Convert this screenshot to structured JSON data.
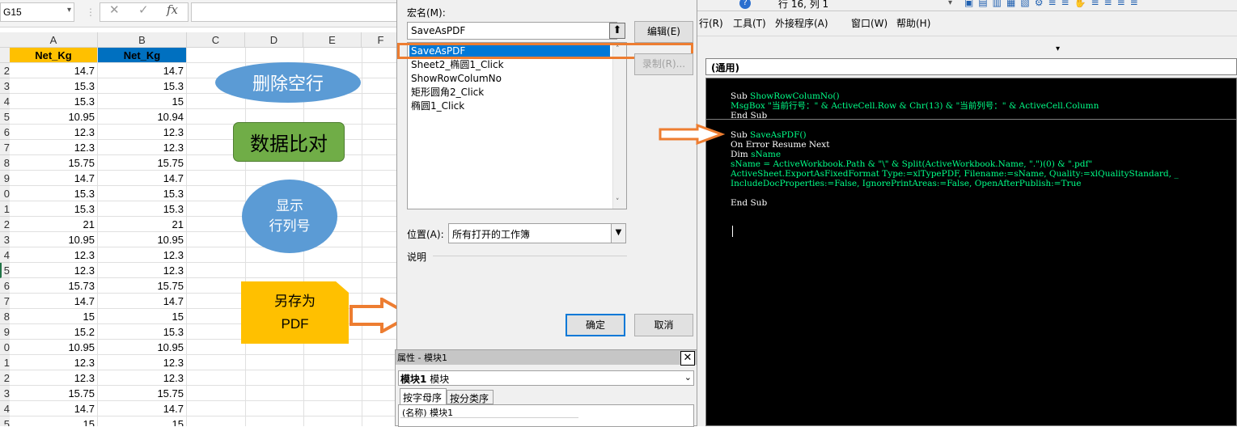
{
  "excel": {
    "name_box": "G15",
    "fx_cancel": "✕",
    "fx_enter": "✓",
    "fx_label": "fx",
    "columns": [
      "A",
      "B",
      "C",
      "D",
      "E",
      "F"
    ],
    "header_a": "Net_Kg",
    "header_b": "Net_Kg",
    "rows": [
      {
        "num": "2",
        "a": "14.7",
        "b": "14.7"
      },
      {
        "num": "3",
        "a": "15.3",
        "b": "15.3"
      },
      {
        "num": "4",
        "a": "15.3",
        "b": "15"
      },
      {
        "num": "5",
        "a": "10.95",
        "b": "10.94"
      },
      {
        "num": "6",
        "a": "12.3",
        "b": "12.3"
      },
      {
        "num": "7",
        "a": "12.3",
        "b": "12.3"
      },
      {
        "num": "8",
        "a": "15.75",
        "b": "15.75"
      },
      {
        "num": "9",
        "a": "14.7",
        "b": "14.7"
      },
      {
        "num": "0",
        "a": "15.3",
        "b": "15.3"
      },
      {
        "num": "1",
        "a": "15.3",
        "b": "15.3"
      },
      {
        "num": "2",
        "a": "21",
        "b": "21"
      },
      {
        "num": "3",
        "a": "10.95",
        "b": "10.95"
      },
      {
        "num": "4",
        "a": "12.3",
        "b": "12.3"
      },
      {
        "num": "5",
        "a": "12.3",
        "b": "12.3"
      },
      {
        "num": "6",
        "a": "15.73",
        "b": "15.75"
      },
      {
        "num": "7",
        "a": "14.7",
        "b": "14.7"
      },
      {
        "num": "8",
        "a": "15",
        "b": "15"
      },
      {
        "num": "9",
        "a": "15.2",
        "b": "15.3"
      },
      {
        "num": "0",
        "a": "10.95",
        "b": "10.95"
      },
      {
        "num": "1",
        "a": "12.3",
        "b": "12.3"
      },
      {
        "num": "2",
        "a": "12.3",
        "b": "12.3"
      },
      {
        "num": "3",
        "a": "15.75",
        "b": "15.75"
      },
      {
        "num": "4",
        "a": "14.7",
        "b": "14.7"
      },
      {
        "num": "5",
        "a": "15",
        "b": "15"
      }
    ],
    "shapes": {
      "delete_blank_rows": "删除空行",
      "data_compare": "数据比对",
      "show_rowcol_line1": "显示",
      "show_rowcol_line2": "行列号",
      "save_as_line1": "另存为",
      "save_as_line2": "PDF"
    },
    "colors": {
      "header_a": "#ffc000",
      "header_b": "#0070c0",
      "oval_blue": "#5b9bd5",
      "green": "#70ad47",
      "yellow": "#ffc000",
      "arrow": "#ed7d31"
    }
  },
  "macro_dialog": {
    "macro_name_label": "宏名(M):",
    "macro_name_value": "SaveAsPDF",
    "macros": [
      "SaveAsPDF",
      "Sheet2_椭圆1_Click",
      "ShowRowColumNo",
      "矩形圆角2_Click",
      "椭圆1_Click"
    ],
    "selected_index": 0,
    "edit_button": "编辑(E)",
    "record_button": "录制(R)...",
    "location_label": "位置(A):",
    "location_value": "所有打开的工作簿",
    "description_label": "说明",
    "ok_button": "确定",
    "cancel_button": "取消"
  },
  "properties": {
    "title": "属性 - 模块1",
    "close": "✕",
    "object_bold": "模块1",
    "object_type": "模块",
    "tab_alpha": "按字母序",
    "tab_category": "按分类序",
    "row_name": "(名称)",
    "row_value": "模块1"
  },
  "vbe": {
    "status": "行 16, 列 1",
    "menu": [
      "行(R)",
      "工具(T)",
      "外接程序(A)",
      "窗口(W)",
      "帮助(H)"
    ],
    "object_combo": "(通用)",
    "code_lines": [
      [
        {
          "t": "Sub ",
          "c": "kw"
        },
        {
          "t": "ShowRowColumNo()",
          "c": "cl"
        }
      ],
      [
        {
          "t": "MsgBox ",
          "c": "cl"
        },
        {
          "t": "\"当前行号：\" & ActiveCell.Row & Chr(13) & \"当前列号：\" & ActiveCell.Column",
          "c": "cl"
        }
      ],
      [
        {
          "t": "End Sub",
          "c": "kw"
        }
      ],
      [],
      [
        {
          "t": "Sub ",
          "c": "kw"
        },
        {
          "t": "SaveAsPDF()",
          "c": "cl"
        }
      ],
      [
        {
          "t": "On Error Resume Next",
          "c": "kw"
        }
      ],
      [
        {
          "t": "Dim ",
          "c": "kw"
        },
        {
          "t": "sName",
          "c": "cl"
        }
      ],
      [
        {
          "t": "sName = ActiveWorkbook.Path & \"\\\" & Split(ActiveWorkbook.Name, \".\")(0) & \".pdf\"",
          "c": "cl"
        }
      ],
      [
        {
          "t": "ActiveSheet.ExportAsFixedFormat Type:=xlTypePDF, Filename:=sName, Quality:=xlQualityStandard, _",
          "c": "cl"
        }
      ],
      [
        {
          "t": "IncludeDocProperties:=False, IgnorePrintAreas:=False, OpenAfterPublish:=True",
          "c": "cl"
        }
      ],
      [],
      [
        {
          "t": "End Sub",
          "c": "kw"
        }
      ]
    ]
  }
}
